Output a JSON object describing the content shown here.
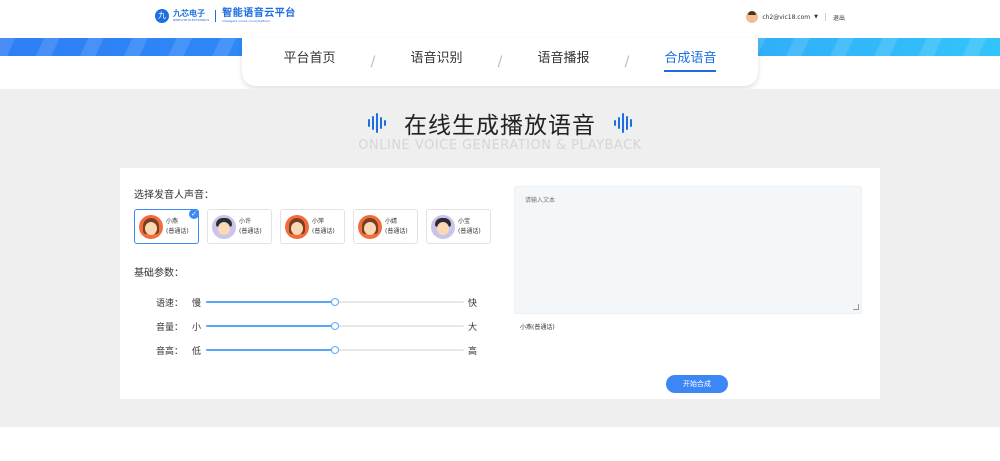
{
  "header": {
    "brand_cn": "九芯电子",
    "brand_en": "NINECHIP ELECTRONICS",
    "title_cn": "智能语音云平台",
    "title_en": "Intelligent online cloud platform",
    "user_email": "ch2@vic18.com",
    "logout_label": "退出"
  },
  "nav": {
    "items": [
      "平台首页",
      "语音识别",
      "语音播报",
      "合成语音"
    ],
    "active": "合成语音",
    "separator": "/"
  },
  "page": {
    "title": "在线生成播放语音",
    "subtitle": "ONLINE VOICE GENERATION & PLAYBACK"
  },
  "voice_section": {
    "label": "选择发音人声音：",
    "voices": [
      {
        "name": "小燕",
        "dialect": "(普通话)",
        "gender": "female",
        "selected": true
      },
      {
        "name": "小许",
        "dialect": "(普通话)",
        "gender": "male",
        "selected": false
      },
      {
        "name": "小萍",
        "dialect": "(普通话)",
        "gender": "female",
        "selected": false
      },
      {
        "name": "小婧",
        "dialect": "(普通话)",
        "gender": "female",
        "selected": false
      },
      {
        "name": "小宝",
        "dialect": "(普通话)",
        "gender": "male",
        "selected": false
      }
    ]
  },
  "params": {
    "label": "基础参数：",
    "sliders": [
      {
        "name": "语速：",
        "min_label": "慢",
        "max_label": "快",
        "value": 0.5
      },
      {
        "name": "音量：",
        "min_label": "小",
        "max_label": "大",
        "value": 0.5
      },
      {
        "name": "音高：",
        "min_label": "低",
        "max_label": "高",
        "value": 0.5
      }
    ]
  },
  "editor": {
    "placeholder": "请输入文本",
    "current_voice": "小燕(普通话)",
    "start_label": "开始合成"
  },
  "colors": {
    "accent": "#1c6fe0",
    "button": "#3d86f6"
  }
}
